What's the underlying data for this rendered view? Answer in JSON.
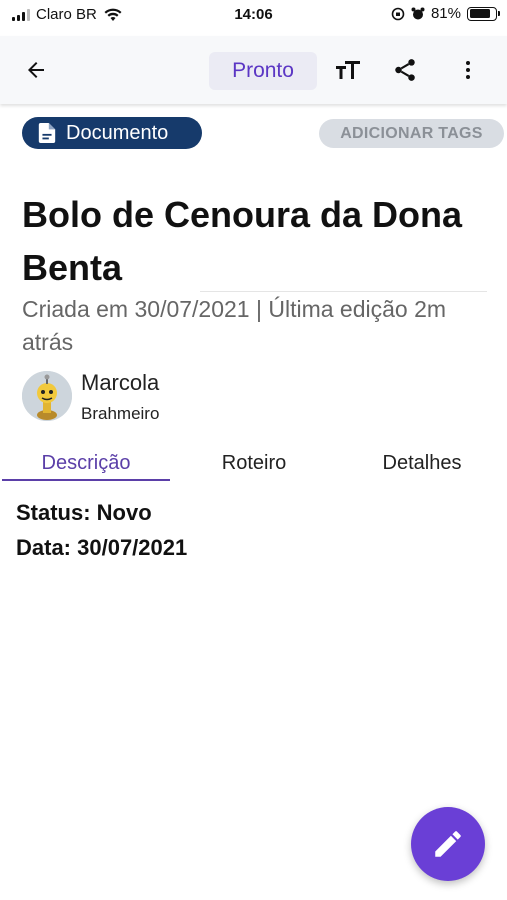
{
  "status_bar": {
    "carrier": "Claro BR",
    "time": "14:06",
    "battery_percent": "81%",
    "battery_level": 0.81
  },
  "toolbar": {
    "status_button_label": "Pronto",
    "text_size_icon": "tT",
    "icons": [
      "back-arrow-icon",
      "text-size-icon",
      "share-icon",
      "more-vert-icon"
    ]
  },
  "document_chip": {
    "label": "Documento",
    "icon": "document-icon"
  },
  "tags_button": {
    "label": "ADICIONAR TAGS"
  },
  "recipe": {
    "title": "Bolo de Cenoura da Dona Benta",
    "meta": "Criada em 30/07/2021 | Última edição 2m atrás"
  },
  "author": {
    "name": "Marcola",
    "role": "Brahmeiro"
  },
  "tabs": [
    {
      "label": "Descrição",
      "active": true
    },
    {
      "label": "Roteiro",
      "active": false
    },
    {
      "label": "Detalhes",
      "active": false
    }
  ],
  "description": {
    "status_line": "Status: Novo",
    "date_line": "Data: 30/07/2021"
  },
  "colors": {
    "accent": "#5b36c4",
    "chip_bg": "#163a6b",
    "fab": "#6a3fd6"
  },
  "fab": {
    "icon": "pencil-edit-icon"
  }
}
